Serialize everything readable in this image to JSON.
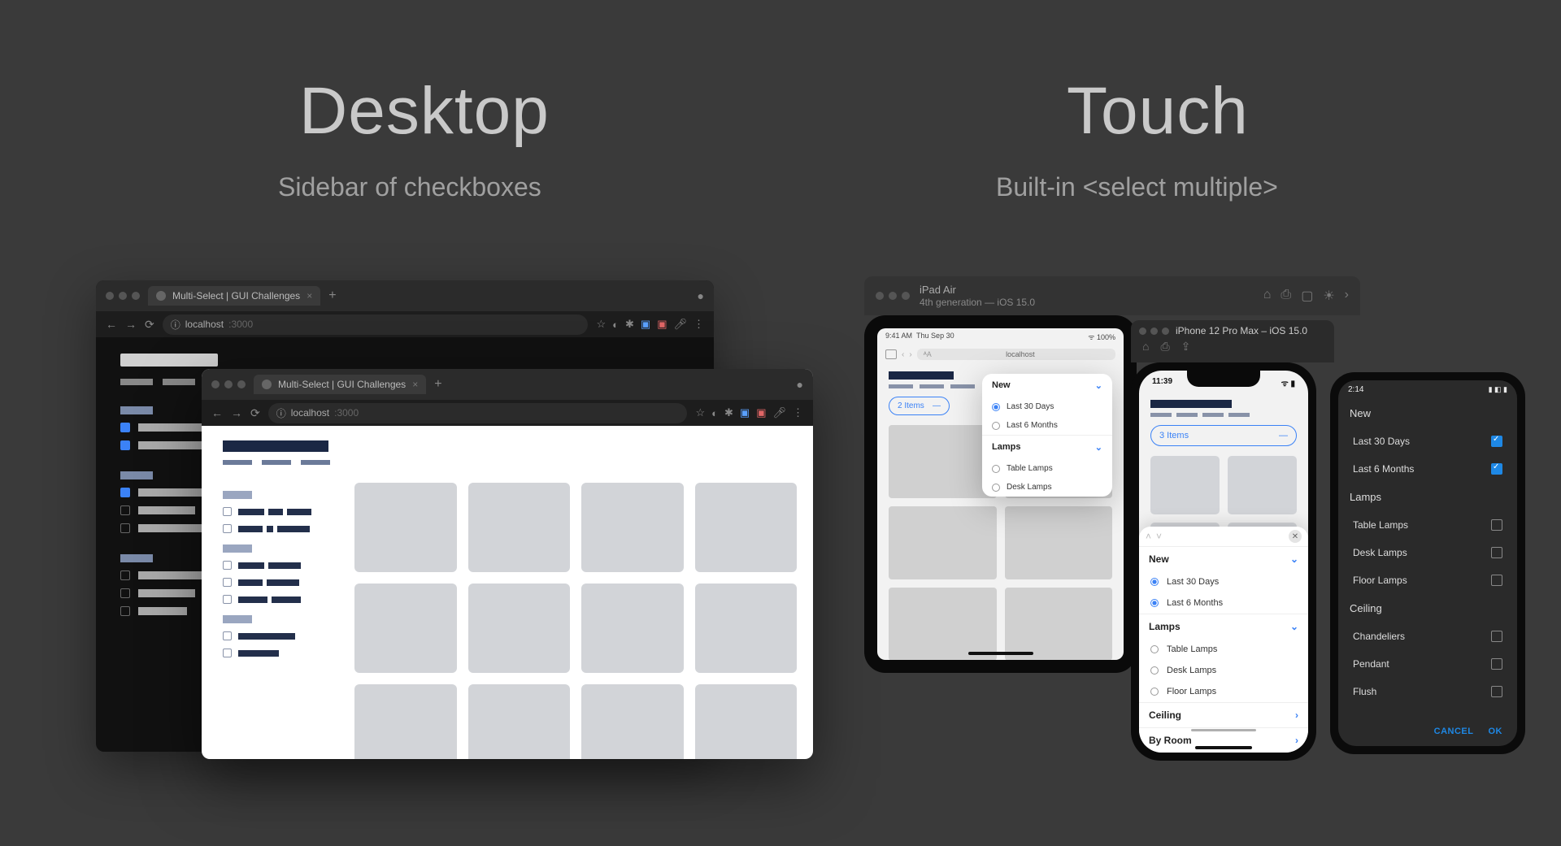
{
  "columns": {
    "desktop": {
      "title": "Desktop",
      "subtitle": "Sidebar of checkboxes"
    },
    "touch": {
      "title": "Touch",
      "subtitle": "Built-in <select multiple>"
    }
  },
  "browser": {
    "tab_title": "Multi-Select | GUI Challenges",
    "url_host": "localhost",
    "url_port": ":3000",
    "close_x": "×",
    "plus": "+"
  },
  "ipad_sim": {
    "device": "iPad Air",
    "detail": "4th generation — iOS 15.0",
    "status_time": "9:41 AM",
    "status_date": "Thu Sep 30",
    "url": "localhost",
    "pill_text": "2 Items",
    "dash": "—",
    "popover": {
      "group1": "New",
      "opt1": "Last 30 Days",
      "opt2": "Last 6 Months",
      "group2": "Lamps",
      "opt3": "Table Lamps",
      "opt4": "Desk Lamps"
    }
  },
  "iphone_sim": {
    "title": "iPhone 12 Pro Max – iOS 15.0",
    "status_time": "11:39",
    "pill_text": "3 Items",
    "dash": "—",
    "sheet": {
      "group1": "New",
      "opt1": "Last 30 Days",
      "opt2": "Last 6 Months",
      "group2": "Lamps",
      "opt3": "Table Lamps",
      "opt4": "Desk Lamps",
      "opt5": "Floor Lamps",
      "group3": "Ceiling",
      "group4": "By Room"
    }
  },
  "android": {
    "status_time": "2:14",
    "groups": [
      {
        "label": "New",
        "items": [
          {
            "label": "Last 30 Days",
            "checked": true
          },
          {
            "label": "Last 6 Months",
            "checked": true
          }
        ]
      },
      {
        "label": "Lamps",
        "items": [
          {
            "label": "Table Lamps",
            "checked": false
          },
          {
            "label": "Desk Lamps",
            "checked": false
          },
          {
            "label": "Floor Lamps",
            "checked": false
          }
        ]
      },
      {
        "label": "Ceiling",
        "items": [
          {
            "label": "Chandeliers",
            "checked": false
          },
          {
            "label": "Pendant",
            "checked": false
          },
          {
            "label": "Flush",
            "checked": false
          }
        ]
      }
    ],
    "cancel": "CANCEL",
    "ok": "OK"
  }
}
